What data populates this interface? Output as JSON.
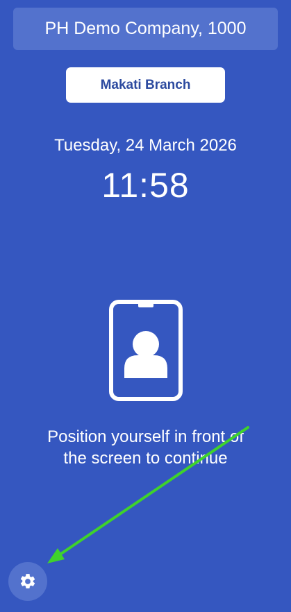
{
  "header": {
    "company_name": "PH Demo Company, 1000"
  },
  "branch": {
    "label": "Makati Branch"
  },
  "clock": {
    "date": "Tuesday, 24 March 2026",
    "time": "11:58"
  },
  "prompt": {
    "instruction": "Position yourself in front of the screen to continue"
  },
  "icons": {
    "badge": "id-badge-person-icon",
    "settings": "gear-icon"
  },
  "colors": {
    "background": "#3557c0",
    "banner": "#5372cd",
    "branch_text": "#2c4a9f",
    "annotation_arrow": "#3fd22c"
  }
}
